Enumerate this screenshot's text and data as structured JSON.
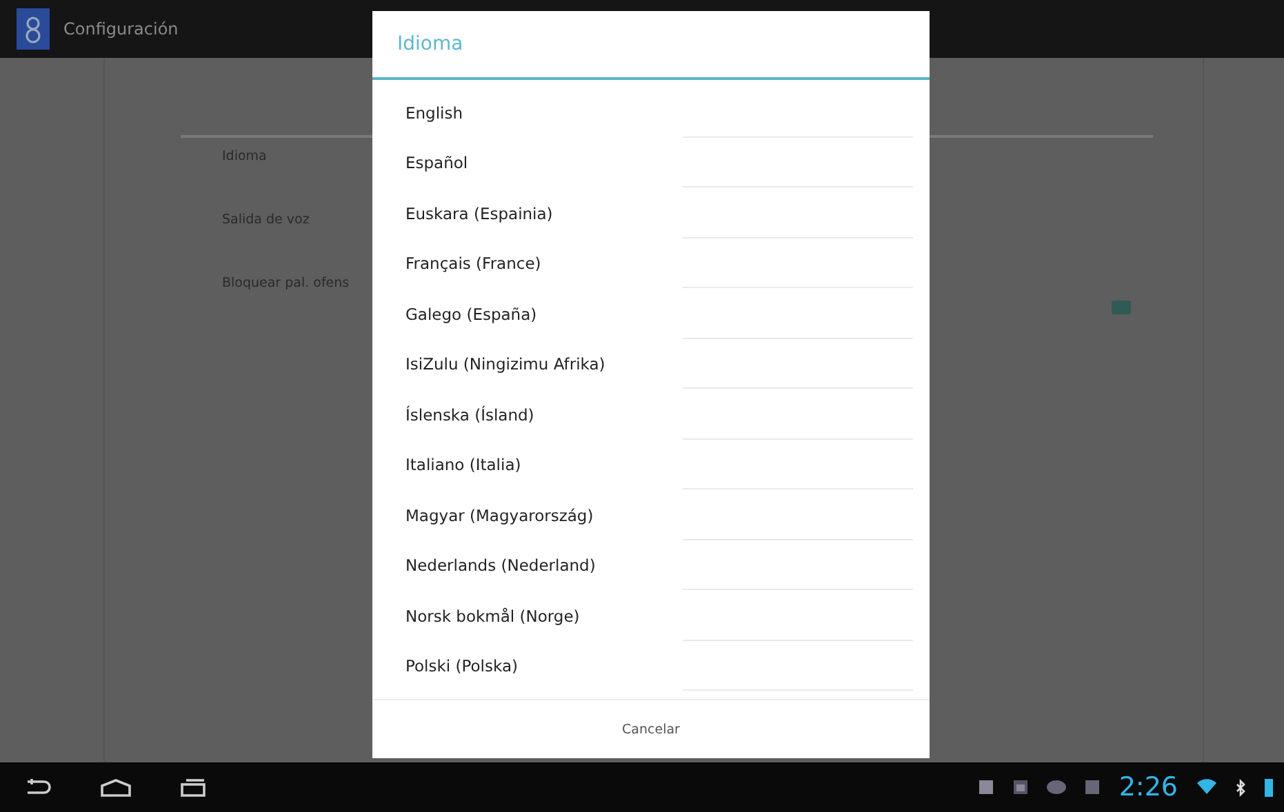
{
  "app_bar": {
    "title": "Configuración"
  },
  "settings": [
    {
      "title": "Idioma"
    },
    {
      "title": "Salida de voz"
    },
    {
      "title": "Bloquear pal. ofens"
    }
  ],
  "offensive_checkbox": {
    "checked": true
  },
  "dialog": {
    "title": "Idioma",
    "languages": [
      {
        "label": "English"
      },
      {
        "label": "Español"
      },
      {
        "label": "Euskara (Espainia)"
      },
      {
        "label": "Français (France)"
      },
      {
        "label": "Galego (España)"
      },
      {
        "label": "IsiZulu (Ningizimu Afrika)"
      },
      {
        "label": "Íslenska (Ísland)"
      },
      {
        "label": "Italiano (Italia)"
      },
      {
        "label": "Magyar (Magyarország)"
      },
      {
        "label": "Nederlands (Nederland)"
      },
      {
        "label": "Norsk bokmål (Norge)"
      },
      {
        "label": "Polski (Polska)"
      }
    ],
    "cancel": "Cancelar"
  },
  "system_bar": {
    "time": "2:26"
  }
}
